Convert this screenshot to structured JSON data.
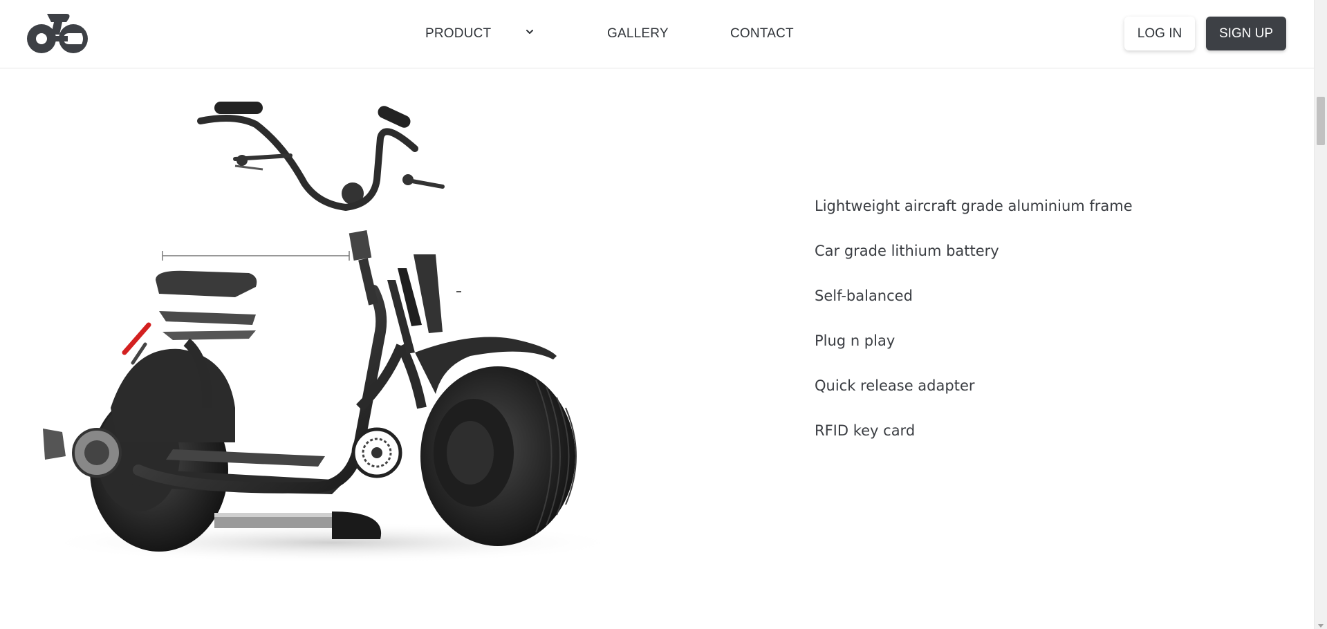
{
  "header": {
    "logo_icon": "scooter-logo-icon",
    "nav": {
      "product_label": "PRODUCT",
      "product_chevron_icon": "chevron-down-icon",
      "gallery_label": "GALLERY",
      "contact_label": "CONTACT"
    },
    "login_label": "LOG IN",
    "signup_label": "SIGN UP"
  },
  "main": {
    "image_icon": "exploded-scooter-image",
    "features": [
      "Lightweight aircraft grade aluminium frame",
      "Car grade lithium battery",
      "Self-balanced",
      "Plug n play",
      "Quick release adapter",
      "RFID key card"
    ]
  },
  "colors": {
    "text": "#2f3338",
    "signup_bg": "#3d4045",
    "accent_red": "#d32020"
  }
}
